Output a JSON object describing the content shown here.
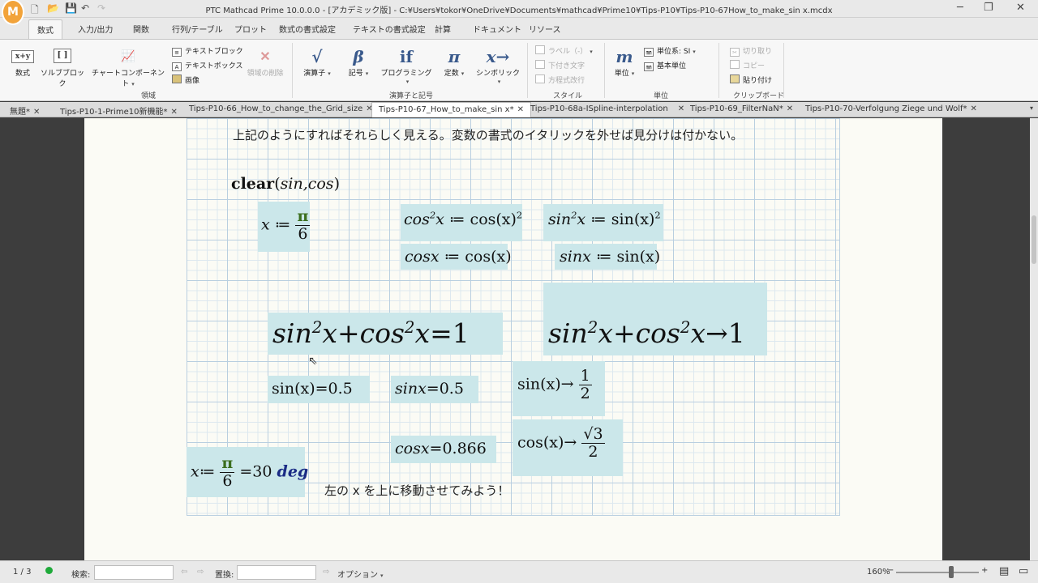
{
  "app": {
    "logo": "M",
    "title": "PTC Mathcad Prime 10.0.0.0 - [アカデミック版] - C:¥Users¥tokor¥OneDrive¥Documents¥mathcad¥Prime10¥Tips-P10¥Tips-P10-67How_to_make_sin x.mcdx"
  },
  "ribbon_tabs": [
    "数式",
    "入力/出力",
    "関数",
    "行列/テーブル",
    "プロット",
    "数式の書式設定",
    "テキストの書式設定",
    "計算",
    "ドキュメント",
    "リソース"
  ],
  "ribbon": {
    "math": "数式",
    "solve_block": "ソルブブロック",
    "chart_component": "チャートコンポーネント",
    "text_block": "テキストブロック",
    "text_box": "テキストボックス",
    "image": "画像",
    "delete_region": "領域の削除",
    "group_regions": "領域",
    "operators": "演算子",
    "symbols": "記号",
    "programming": "プログラミング",
    "constants": "定数",
    "symbolic": "シンボリック",
    "group_operators": "演算子と記号",
    "label": "ラベル（-）",
    "subscript": "下付き文字",
    "eq_break": "方程式改行",
    "group_style": "スタイル",
    "units": "単位",
    "unit_system": "単位系: SI",
    "base_unit": "基本単位",
    "group_units": "単位",
    "cut": "切り取り",
    "copy": "コピー",
    "paste": "貼り付け",
    "group_clipboard": "クリップボード",
    "icons": {
      "math": "x+y",
      "operators": "√",
      "symbols": "β",
      "programming": "if",
      "constants": "π",
      "symbolic": "x→",
      "units": "m"
    }
  },
  "doc_tabs": [
    "無題*",
    "Tips-P10-1-Prime10新機能*",
    "Tips-P10-66_How_to_change_the_Grid_size",
    "Tips-P10-67_How_to_make_sin x*",
    "Tips-P10-68a-ISpline-interpolation",
    "Tips-P10-69_FilterNaN*",
    "Tips-P10-70-Verfolgung Ziege und Wolf*"
  ],
  "worksheet": {
    "note_top": "上記のようにすればそれらしく見える。変数の書式のイタリックを外せば見分けは付かない。",
    "note_bottom": "左の x を上に移動させてみよう！",
    "clear": {
      "func": "clear",
      "args": "sin,cos"
    },
    "def_x": {
      "lhs": "x",
      "op": "≔",
      "num": "π",
      "den": "6"
    },
    "def_cos2": {
      "lhs": "cos",
      "sup": "2",
      "var": "x",
      "op": "≔",
      "rhs": "cos(x)",
      "rsup": "2"
    },
    "def_sin2": {
      "lhs": "sin",
      "sup": "2",
      "var": "x",
      "op": "≔",
      "rhs": "sin(x)",
      "rsup": "2"
    },
    "def_cosx": {
      "lhs": "cosx",
      "op": "≔",
      "rhs": "cos(x)"
    },
    "def_sinx": {
      "lhs": "sinx",
      "op": "≔",
      "rhs": "sin(x)"
    },
    "identity_eval": {
      "a": "sin",
      "b": "cos",
      "sup": "2",
      "var": "x",
      "plus": "+",
      "op": "=",
      "result": "1"
    },
    "identity_sym": {
      "a": "sin",
      "b": "cos",
      "sup": "2",
      "var": "x",
      "plus": "+",
      "op": "→",
      "result": "1"
    },
    "eval_sin": {
      "expr": "sin(x)",
      "op": "=",
      "val": "0.5"
    },
    "eval_sinx": {
      "expr": "sinx",
      "op": "=",
      "val": "0.5"
    },
    "sym_sin": {
      "expr": "sin(x)",
      "op": "→",
      "num": "1",
      "den": "2"
    },
    "eval_cosx": {
      "expr": "cosx",
      "op": "=",
      "val": "0.866"
    },
    "sym_cos": {
      "expr": "cos(x)",
      "op": "→",
      "num": "√3",
      "den": "2"
    },
    "def_x_deg": {
      "lhs": "x",
      "op": "≔",
      "num": "π",
      "den": "6",
      "eq": "=",
      "val": "30",
      "unit": "deg"
    }
  },
  "status": {
    "page": "1 / 3",
    "find_label": "検索:",
    "find_value": "",
    "replace_label": "置換:",
    "replace_value": "",
    "options": "オプション",
    "zoom": "160%"
  }
}
